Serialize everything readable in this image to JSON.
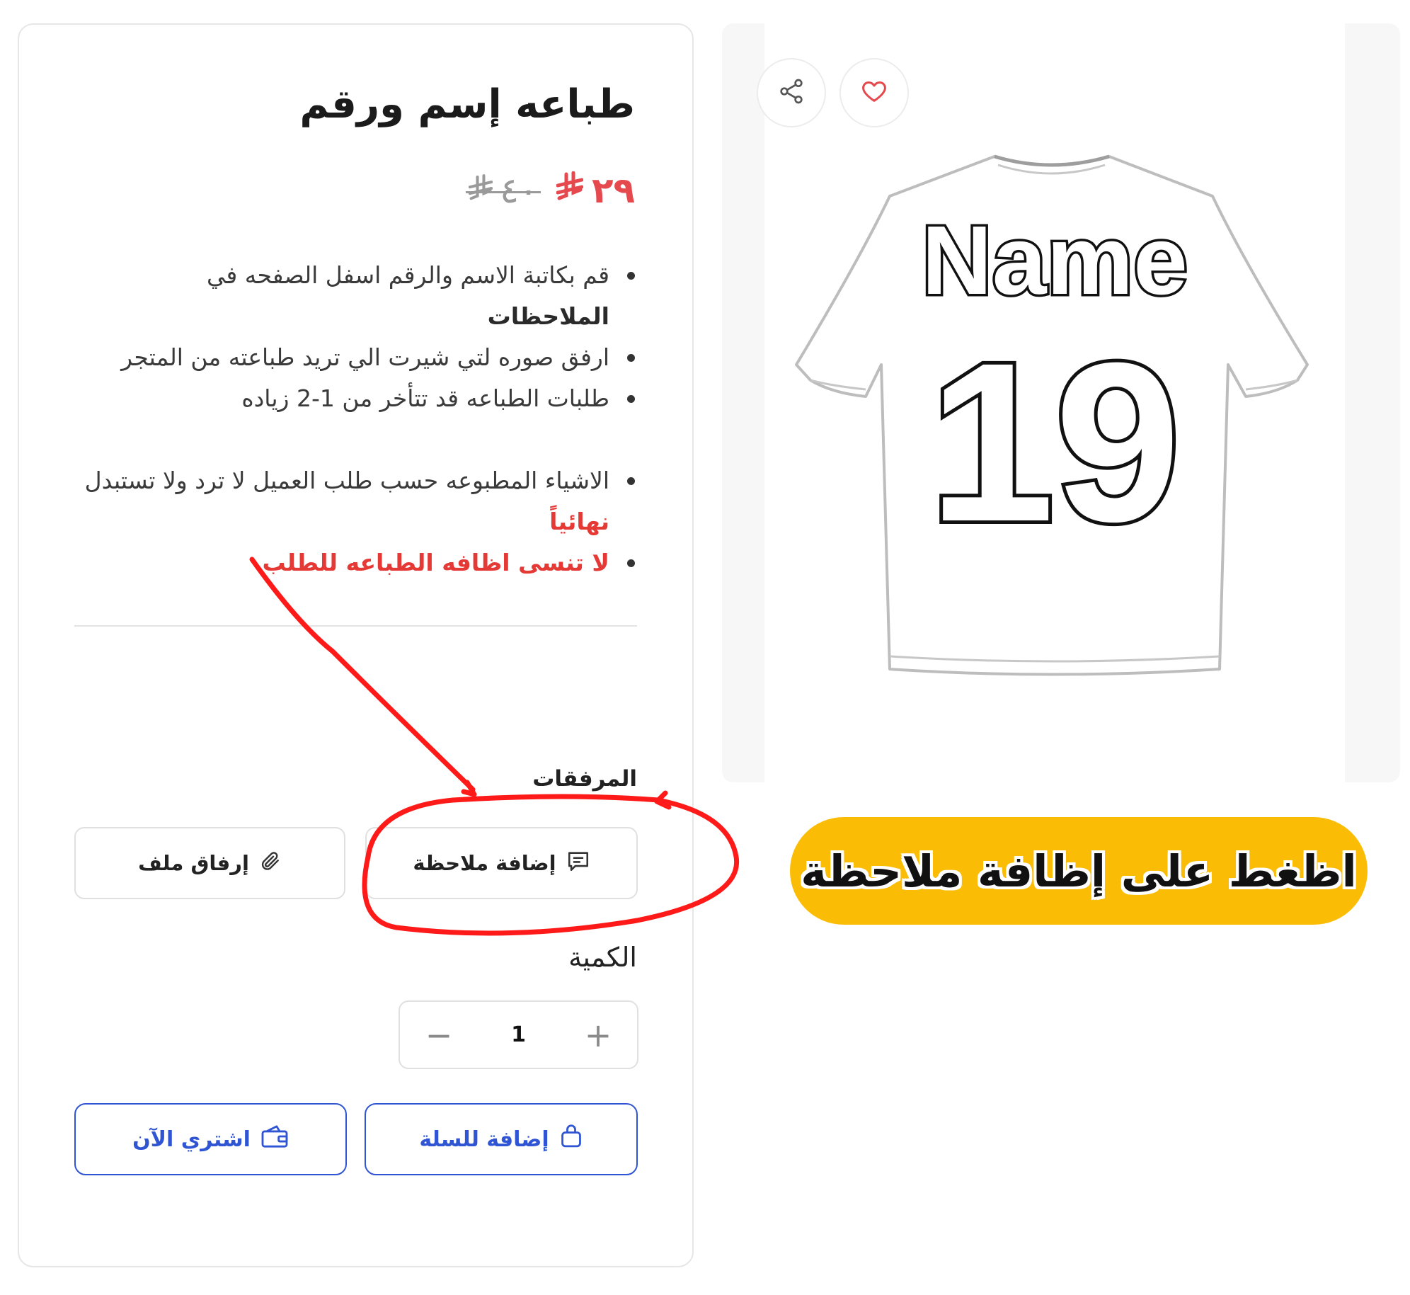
{
  "product": {
    "title": "طباعه إسم ورقم",
    "price_now": "٢٩",
    "price_old": "٤٠",
    "currency_symbol": "⃁"
  },
  "description": {
    "item1_text": "قم بكاتبة الاسم والرقم اسفل الصفحه في",
    "item1_bold": "الملاحظات",
    "item2": "ارفق صوره لتي شيرت الي تريد طباعته من المتجر",
    "item3": "طلبات الطباعه قد تتأخر من 1-2 زياده",
    "item4_text": "الاشياء المطبوعه حسب طلب العميل لا ترد ولا تستبدل",
    "item4_red": "نهائياً",
    "item5_red": "لا تنسى اظافه الطباعه للطلب"
  },
  "attachments": {
    "label": "المرفقات",
    "add_note": "إضافة ملاحظة",
    "attach_file": "إرفاق ملف"
  },
  "quantity": {
    "label": "الكمية",
    "value": "1",
    "plus": "+",
    "minus": "−"
  },
  "actions": {
    "add_to_cart": "إضافة للسلة",
    "buy_now": "اشتري الآن"
  },
  "image": {
    "jersey_name": "Name",
    "jersey_number": "19"
  },
  "annotation": {
    "callout": "اظغط على إظافة ملاحظة",
    "colors": {
      "callout_bg": "#fbbc05",
      "ink": "#ff1a1a",
      "primary": "#2f55d4",
      "price": "#e5484d"
    }
  }
}
